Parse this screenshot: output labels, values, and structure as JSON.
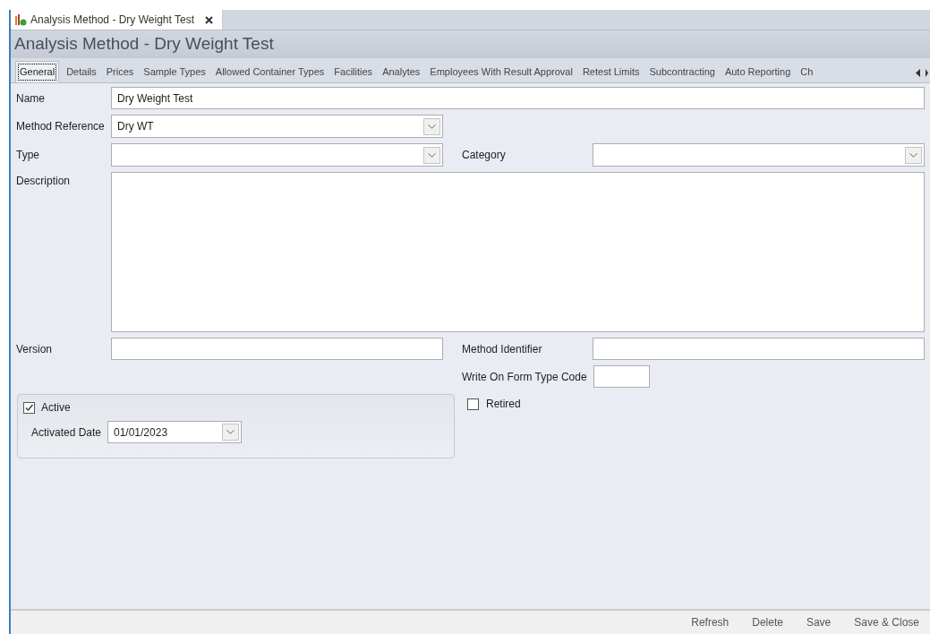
{
  "document_tab": {
    "title": "Analysis Method - Dry Weight Test"
  },
  "title": "Analysis Method - Dry Weight Test",
  "tabs": [
    {
      "label": "General",
      "selected": true
    },
    {
      "label": "Details",
      "selected": false
    },
    {
      "label": "Prices",
      "selected": false
    },
    {
      "label": "Sample Types",
      "selected": false
    },
    {
      "label": "Allowed Container Types",
      "selected": false
    },
    {
      "label": "Facilities",
      "selected": false
    },
    {
      "label": "Analytes",
      "selected": false
    },
    {
      "label": "Employees With Result Approval",
      "selected": false
    },
    {
      "label": "Retest Limits",
      "selected": false
    },
    {
      "label": "Subcontracting",
      "selected": false
    },
    {
      "label": "Auto Reporting",
      "selected": false
    },
    {
      "label": "Ch",
      "selected": false
    }
  ],
  "form": {
    "name": {
      "label": "Name",
      "value": "Dry Weight Test"
    },
    "method_reference": {
      "label": "Method Reference",
      "value": "Dry WT"
    },
    "type": {
      "label": "Type"
    },
    "category": {
      "label": "Category"
    },
    "description": {
      "label": "Description"
    },
    "version": {
      "label": "Version"
    },
    "method_identifier": {
      "label": "Method Identifier"
    },
    "write_on_form_type_code": {
      "label": "Write On Form Type Code"
    },
    "active": {
      "label": "Active",
      "checked": true
    },
    "activated_date": {
      "label": "Activated Date",
      "value": "01/01/2023"
    },
    "retired": {
      "label": "Retired",
      "checked": false
    }
  },
  "buttons": [
    "Refresh",
    "Delete",
    "Save",
    "Save & Close"
  ]
}
